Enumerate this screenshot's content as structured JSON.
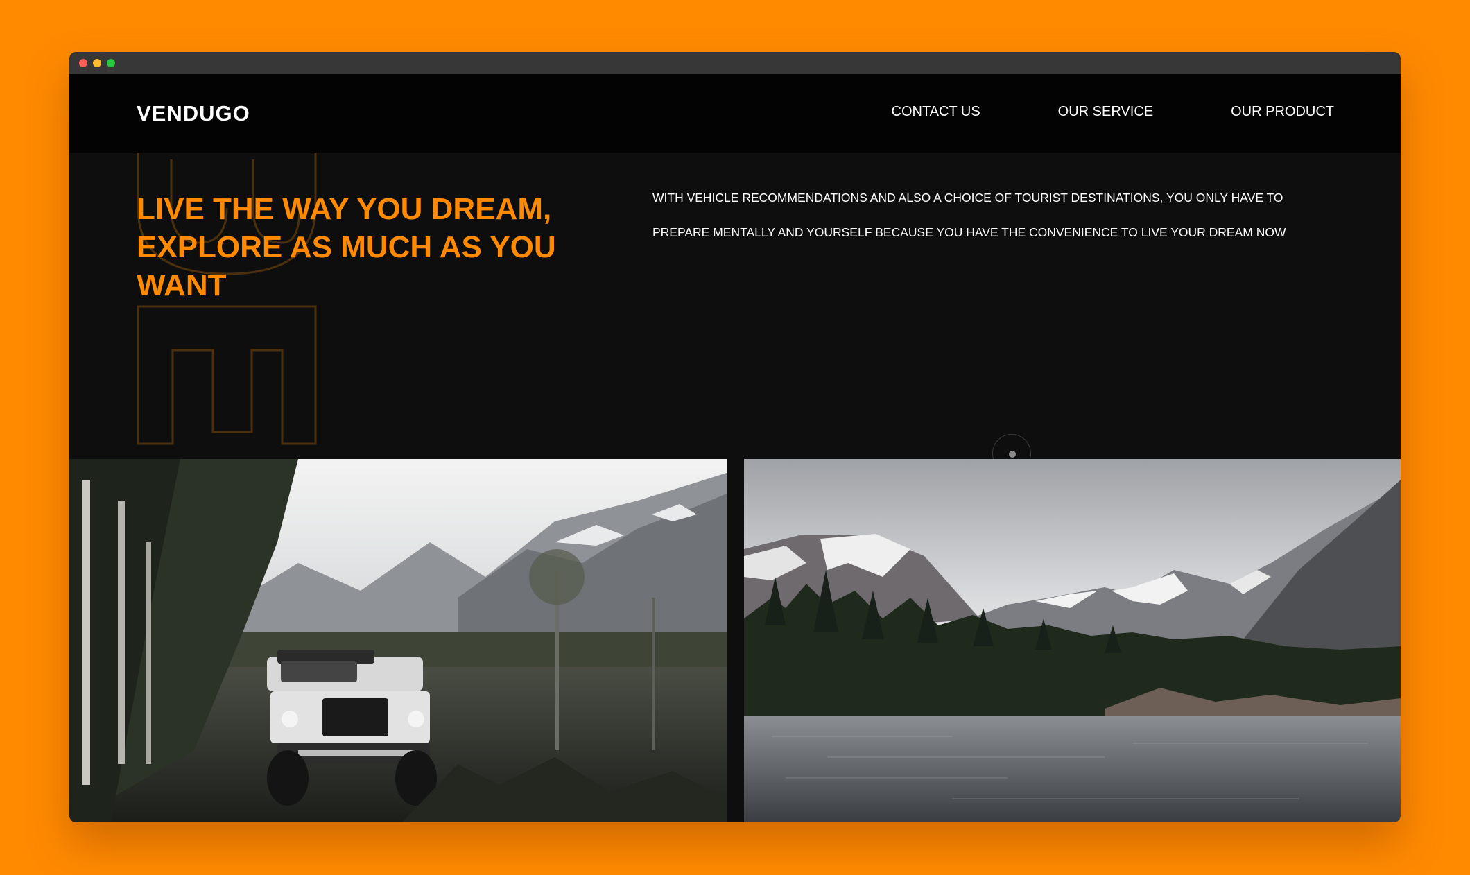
{
  "window": {
    "controls": [
      "close",
      "minimize",
      "maximize"
    ]
  },
  "nav": {
    "logo": "VENDUGO",
    "links": [
      "CONTACT US",
      "OUR SERVICE",
      "OUR PRODUCT"
    ]
  },
  "hero": {
    "headline": "LIVE THE WAY YOU DREAM, EXPLORE AS MUCH AS YOU WANT",
    "description": "WITH VEHICLE RECOMMENDATIONS AND ALSO A CHOICE OF TOURIST DESTINATIONS, YOU ONLY HAVE TO PREPARE MENTALLY AND YOURSELF BECAUSE YOU HAVE THE CONVENIENCE TO LIVE YOUR DREAM NOW"
  },
  "images": [
    {
      "subject": "white pickup truck on forest trail with snowy mountains"
    },
    {
      "subject": "mountain lake with pine forest and snow-capped peaks"
    }
  ],
  "colors": {
    "accent": "#ff8a00",
    "background": "#0e0e0e",
    "navbar": "#030303"
  }
}
